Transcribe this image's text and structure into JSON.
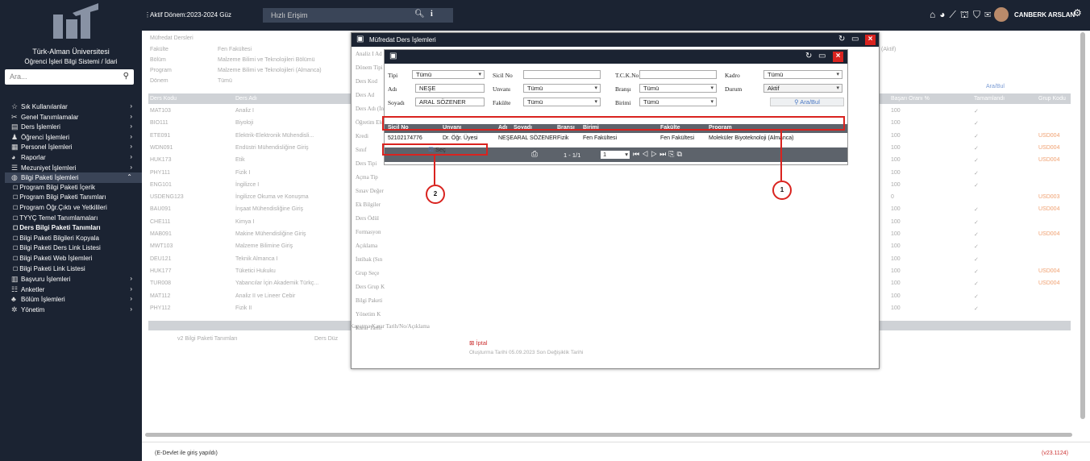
{
  "sidebar": {
    "university": "Türk-Alman Üniversitesi",
    "system": "Öğrenci İşleri Bilgi Sistemi / İdari",
    "search_placeholder": "Ara...",
    "items": [
      {
        "label": "Sık Kullanılanlar",
        "icon": "star-icon"
      },
      {
        "label": "Genel Tanımlamalar",
        "icon": "tools-icon"
      },
      {
        "label": "Ders İşlemleri",
        "icon": "book-icon"
      },
      {
        "label": "Öğrenci İşlemleri",
        "icon": "student-icon"
      },
      {
        "label": "Personel İşlemleri",
        "icon": "staff-icon"
      },
      {
        "label": "Raporlar",
        "icon": "chart-icon"
      },
      {
        "label": "Mezuniyet İşlemleri",
        "icon": "grad-icon"
      },
      {
        "label": "Bilgi Paketi İşlemleri",
        "icon": "globe-icon"
      }
    ],
    "subitems": [
      "Program Bilgi Paketi İçerik",
      "Program Bilgi Paketi Tanımları",
      "Program Öğr.Çıktı ve Yetkilileri",
      "TYYÇ Temel Tanımlamaları",
      "Ders Bilgi Paketi Tanımları",
      "Bilgi Paketi Bilgileri Kopyala",
      "Bilgi Paketi Ders Link Listesi",
      "Bilgi Paketi Web İşlemleri",
      "Bilgi Paketi Link Listesi"
    ],
    "items2": [
      {
        "label": "Başvuru İşlemleri",
        "icon": "form-icon"
      },
      {
        "label": "Anketler",
        "icon": "list-icon"
      },
      {
        "label": "Bölüm İşlemleri",
        "icon": "people-icon"
      },
      {
        "label": "Yönetim",
        "icon": "gears-icon"
      }
    ]
  },
  "topbar": {
    "period": "Aktif Dönem:2023-2024 Güz",
    "quick_access": "Hızlı Erişim",
    "user": "CANBERK ARSLAN"
  },
  "background": {
    "form_title": "Müfredat Dersleri",
    "labels": [
      "Fakülte",
      "Bölüm",
      "Program",
      "Dönem"
    ],
    "values": [
      "Fen Fakültesi",
      "Malzeme Bilimi ve Teknolojileri Bölümü",
      "Malzeme Bilimi ve Teknolojileri (Almanca)",
      "Tümü"
    ],
    "right_select": "(Aktif)",
    "right_button": "Ara/Bul",
    "col_headers": [
      "Ders Kodu",
      "Ders Adı",
      "Başarı Oranı %",
      "Tamamlandı",
      "Grup Kodu"
    ],
    "rows": [
      [
        "MAT103",
        "Analiz I",
        "100",
        "✓",
        ""
      ],
      [
        "BIO111",
        "Biyoloji",
        "100",
        "✓",
        ""
      ],
      [
        "ETE091",
        "Elektrik-Elektronik Mühendisli...",
        "100",
        "✓",
        "USD004"
      ],
      [
        "WDN091",
        "Endüstri Mühendisliğine Giriş",
        "100",
        "✓",
        "USD004"
      ],
      [
        "HUK173",
        "Etik",
        "100",
        "✓",
        "USD004"
      ],
      [
        "PHY111",
        "Fizik I",
        "100",
        "✓",
        ""
      ],
      [
        "ENG101",
        "İngilizce I",
        "100",
        "✓",
        ""
      ],
      [
        "USDENG123",
        "İngilizce Okuma ve Konuşma",
        "0",
        "",
        "USD003"
      ],
      [
        "BAU091",
        "İnşaat Mühendisliğine Giriş",
        "100",
        "✓",
        "USD004"
      ],
      [
        "CHE111",
        "Kimya I",
        "100",
        "✓",
        ""
      ],
      [
        "MAB091",
        "Makine Mühendisliğine Giriş",
        "100",
        "✓",
        "USD004"
      ],
      [
        "MWT103",
        "Malzeme Bilimine Giriş",
        "100",
        "✓",
        ""
      ],
      [
        "DEU121",
        "Teknik Almanca I",
        "100",
        "✓",
        ""
      ],
      [
        "HUK177",
        "Tüketici Hukuku",
        "100",
        "✓",
        "USD004"
      ],
      [
        "TUR008",
        "Yabancılar İçin Akademik Türkç...",
        "100",
        "✓",
        "USD004"
      ],
      [
        "MAT112",
        "Analiz II ve Lineer Cebir",
        "100",
        "✓",
        ""
      ],
      [
        "PHY112",
        "Fizik II",
        "100",
        "✓",
        ""
      ]
    ],
    "bottom_tabs": [
      "v2 Bilgi Paketi Tanımları",
      "Ders Düz"
    ],
    "status": "(E-Devlet ile giriş yapıldı)",
    "version": "(v23.1124)"
  },
  "modal": {
    "title": "Müfredat Ders İşlemleri",
    "side_labels": [
      "Analiz I Ad",
      "Dönem Tipi",
      "Ders Kod",
      "Ders Ad",
      "Ders Adı (İn",
      "Öğretim Ele",
      "Kredi",
      "Sınıf",
      "Ders Tipi",
      "Açma Tip",
      "Sınav Değer",
      "Ek Bilgiler",
      "Ders Ödül",
      "Formasyon",
      "Açıklama",
      "İntibak (Sın",
      "Grup Seçe",
      "Ders Grup K",
      "Bilgi Paketi",
      "Yönetim K",
      "Karar Tarih",
      "Kapatma Karar Tarih/No/Açıklama"
    ],
    "iptal": "İptal",
    "footer": "Oluşturma Tarihi 05.09.2023 Son Değişiklik Tarihi"
  },
  "search_form": {
    "labels": {
      "tipi": "Tipi",
      "sicil": "Sicil No",
      "tckn": "T.C.K.No",
      "kadro": "Kadro",
      "adi": "Adı",
      "unvan": "Unvanı",
      "brans": "Branşı",
      "durum": "Durum",
      "soyadi": "Soyadı",
      "fakulte": "Fakülte",
      "birimi": "Birimi"
    },
    "values": {
      "tipi": "Tümü",
      "sicil": "",
      "tckn": "",
      "kadro": "Tümü",
      "adi": "NEŞE",
      "unvan": "Tümü",
      "brans": "Tümü",
      "durum": "Aktif",
      "soyadi": "ARAL SÖZENER",
      "fakulte": "Tümü",
      "birimi": "Tümü"
    },
    "search_button": "Ara/Bul"
  },
  "results": {
    "headers": [
      "Sicil No",
      "Unvanı",
      "Adı",
      "Soyadı",
      "Branşı",
      "Birimi",
      "Fakülte",
      "Program"
    ],
    "row": [
      "52102174776",
      "Dr. Öğr. Üyesi",
      "NEŞE",
      "ARAL SÖZENER",
      "Fizik",
      "Fen Fakültesi",
      "Fen Fakültesi",
      "Moleküler Biyoteknoloji (Almanca)"
    ],
    "page_info": "1 - 1/1",
    "page_select": "1",
    "select_button": "Seç"
  },
  "annotations": [
    "1",
    "2"
  ],
  "colors": {
    "sidebar": "#1b2332",
    "highlight": "#d9231f",
    "grid_header": "#5d636b"
  }
}
